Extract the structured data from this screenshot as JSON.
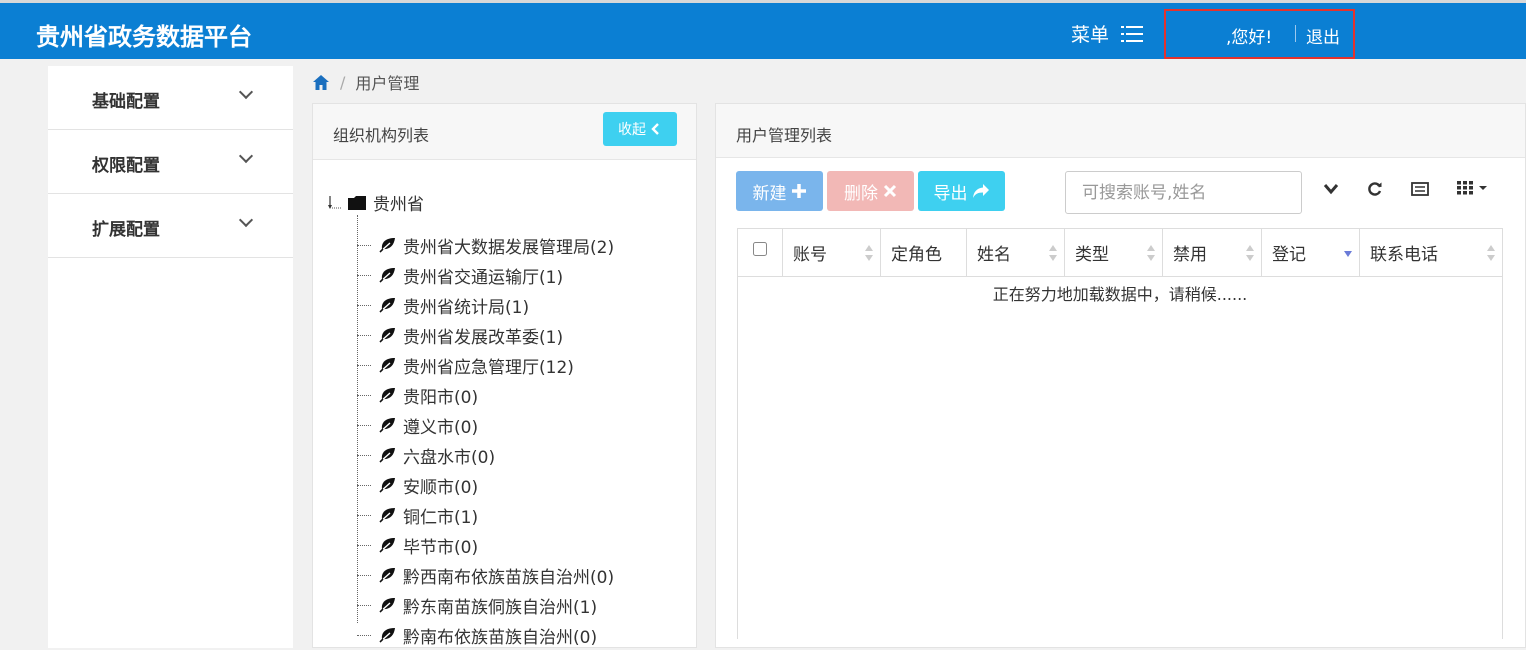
{
  "header": {
    "brand": "贵州省政务数据平台",
    "menu_label": "菜单",
    "greeting": ",您好!",
    "logout": "退出"
  },
  "sidebar": {
    "items": [
      {
        "label": "基础配置"
      },
      {
        "label": "权限配置"
      },
      {
        "label": "扩展配置"
      }
    ]
  },
  "breadcrumb": {
    "current": "用户管理",
    "separator": "/"
  },
  "org_panel": {
    "title": "组织机构列表",
    "collapse_label": "收起",
    "root": "贵州省",
    "children": [
      "贵州省大数据发展管理局(2)",
      "贵州省交通运输厅(1)",
      "贵州省统计局(1)",
      "贵州省发展改革委(1)",
      "贵州省应急管理厅(12)",
      "贵阳市(0)",
      "遵义市(0)",
      "六盘水市(0)",
      "安顺市(0)",
      "铜仁市(1)",
      "毕节市(0)",
      "黔西南布依族苗族自治州(0)",
      "黔东南苗族侗族自治州(1)",
      "黔南布依族苗族自治州(0)"
    ]
  },
  "user_panel": {
    "title": "用户管理列表",
    "buttons": {
      "new": "新建",
      "delete": "删除",
      "export": "导出"
    },
    "search_placeholder": "可搜索账号,姓名",
    "columns": [
      "账号",
      "定角色",
      "姓名",
      "类型",
      "禁用",
      "登记",
      "联系电话"
    ],
    "loading_text": "正在努力地加载数据中，请稍候......"
  },
  "colors": {
    "topbar": "#0b7fd3",
    "new_button": "#7ab5ec",
    "delete_button": "#f2b8b6",
    "export_button": "#3ed0f0",
    "highlight_box": "#e5322d"
  }
}
